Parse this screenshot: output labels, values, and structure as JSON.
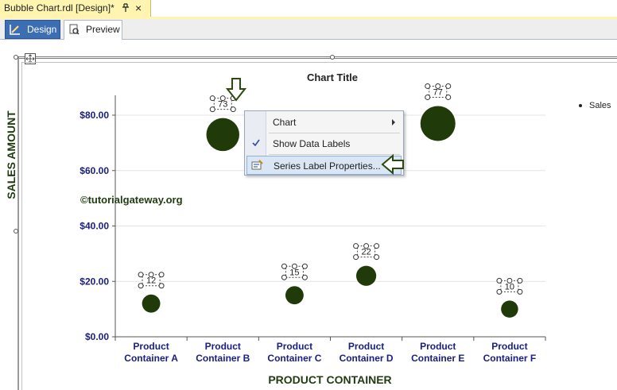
{
  "document_tab": {
    "title": "Bubble Chart.rdl [Design]*",
    "close_glyph": "×",
    "pin_icon": "pin-icon"
  },
  "view_tabs": [
    {
      "label": "Design",
      "active": true,
      "icon": "design-ruler-icon"
    },
    {
      "label": "Preview",
      "active": false,
      "icon": "preview-icon"
    }
  ],
  "watermark": "©tutorialgateway.org",
  "context_menu": {
    "items": [
      {
        "label": "Chart",
        "has_submenu": true
      },
      {
        "label": "Show Data Labels",
        "checked": true
      },
      {
        "label": "Series Label Properties...",
        "highlighted": true
      }
    ]
  },
  "colors": {
    "bubble": "#213a0a",
    "axis_text": "#1a2080",
    "accent_tab": "#3c6eb4",
    "doc_tab": "#fff5b0"
  },
  "chart_data": {
    "type": "scatter",
    "title": "Chart Title",
    "xlabel": "PRODUCT CONTAINER",
    "ylabel": "SALES AMOUNT",
    "categories": [
      "Product Container A",
      "Product Container B",
      "Product Container C",
      "Product Container D",
      "Product Container E",
      "Product Container F"
    ],
    "category_lines": [
      [
        "Product",
        "Container A"
      ],
      [
        "Product",
        "Container B"
      ],
      [
        "Product",
        "Container C"
      ],
      [
        "Product",
        "Container D"
      ],
      [
        "Product",
        "Container E"
      ],
      [
        "Product",
        "Container F"
      ]
    ],
    "y_ticks": [
      "$0.00",
      "$20.00",
      "$40.00",
      "$60.00",
      "$80.00"
    ],
    "y_tick_values": [
      0,
      20,
      40,
      60,
      80
    ],
    "ylim": [
      0,
      88
    ],
    "grid": true,
    "legend_position": "top-right",
    "series": [
      {
        "name": "Sales",
        "values": [
          12,
          73,
          15,
          22,
          77,
          10
        ],
        "labels": [
          "12",
          "73",
          "15",
          "22",
          "77",
          "10"
        ],
        "bubble_size": [
          1,
          6,
          1,
          1.4,
          7,
          0.8
        ]
      }
    ]
  }
}
